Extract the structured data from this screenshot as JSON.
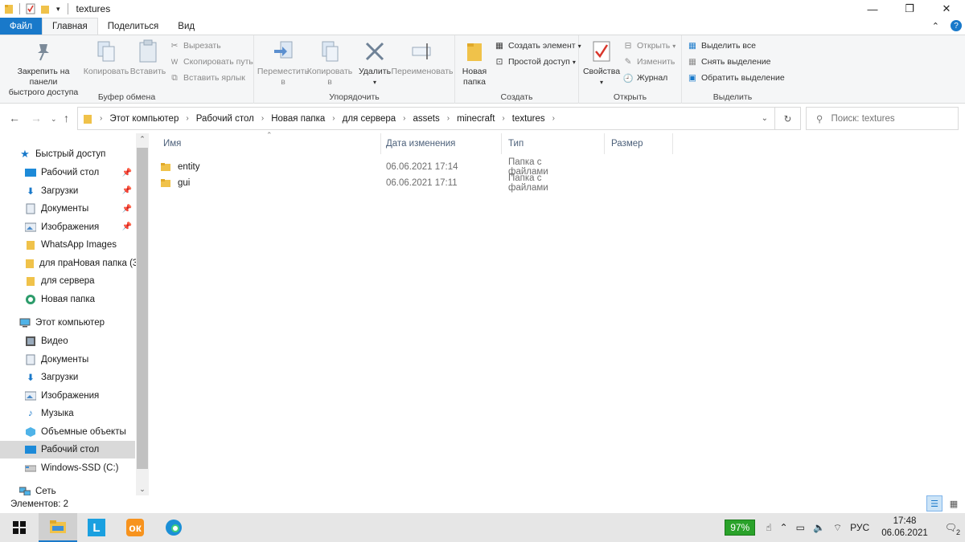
{
  "window": {
    "title": "textures"
  },
  "tabs": {
    "file": "Файл",
    "home": "Главная",
    "share": "Поделиться",
    "view": "Вид"
  },
  "ribbon": {
    "clipboard": {
      "pin_label_1": "Закрепить на панели",
      "pin_label_2": "быстрого доступа",
      "copy": "Копировать",
      "paste": "Вставить",
      "cut": "Вырезать",
      "copy_path": "Скопировать путь",
      "paste_shortcut": "Вставить ярлык",
      "group": "Буфер обмена"
    },
    "organize": {
      "move_1": "Переместить",
      "move_2": "в",
      "copy_1": "Копировать",
      "copy_2": "в",
      "delete": "Удалить",
      "rename": "Переименовать",
      "group": "Упорядочить"
    },
    "create": {
      "new_folder_1": "Новая",
      "new_folder_2": "папка",
      "new_item": "Создать элемент",
      "easy_access": "Простой доступ",
      "group": "Создать"
    },
    "open": {
      "properties": "Свойства",
      "open": "Открыть",
      "edit": "Изменить",
      "history": "Журнал",
      "group": "Открыть"
    },
    "select": {
      "select_all": "Выделить все",
      "select_none": "Снять выделение",
      "invert": "Обратить выделение",
      "group": "Выделить"
    }
  },
  "address": {
    "crumbs": [
      "Этот компьютер",
      "Рабочий стол",
      "Новая папка",
      "для сервера",
      "assets",
      "minecraft",
      "textures"
    ]
  },
  "search": {
    "placeholder": "Поиск: textures"
  },
  "nav": {
    "quick_access": "Быстрый доступ",
    "quick_items": [
      "Рабочий стол",
      "Загрузки",
      "Документы",
      "Изображения",
      "WhatsApp Images",
      "для праНовая папка (3)",
      "для сервера",
      "Новая папка"
    ],
    "this_pc": "Этот компьютер",
    "pc_items": [
      "Видео",
      "Документы",
      "Загрузки",
      "Изображения",
      "Музыка",
      "Объемные объекты",
      "Рабочий стол",
      "Windows-SSD (C:)"
    ],
    "network": "Сеть"
  },
  "columns": {
    "name": "Имя",
    "date": "Дата изменения",
    "type": "Тип",
    "size": "Размер"
  },
  "files": [
    {
      "name": "entity",
      "date": "06.06.2021 17:14",
      "type": "Папка с файлами"
    },
    {
      "name": "gui",
      "date": "06.06.2021 17:11",
      "type": "Папка с файлами"
    }
  ],
  "status": {
    "count": "Элементов: 2"
  },
  "tray": {
    "battery": "97%",
    "lang": "РУС",
    "time": "17:48",
    "date": "06.06.2021",
    "notif": "2"
  },
  "colors": {
    "accent": "#1979ca",
    "folder": "#f0c24a",
    "selected": "#d9d9d9"
  }
}
